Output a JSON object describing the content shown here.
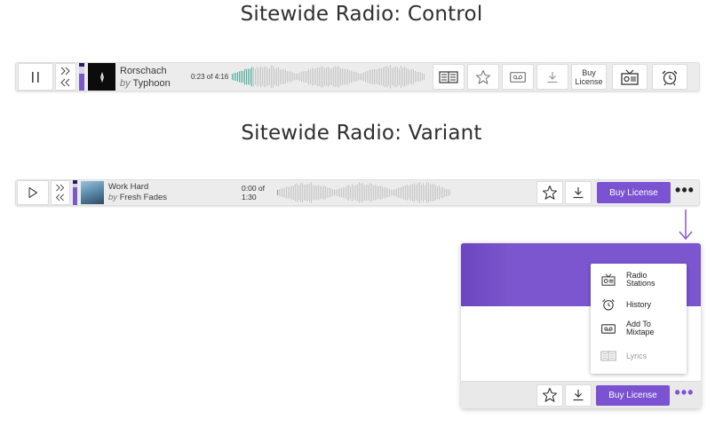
{
  "titles": {
    "control": "Sitewide Radio: Control",
    "variant": "Sitewide Radio: Variant"
  },
  "control_bar": {
    "track_title": "Rorschach",
    "artist_prefix": "by",
    "artist": "Typhoon",
    "time": "0:23 of 4:16",
    "buy_label_line1": "Buy",
    "buy_label_line2": "License",
    "icons": [
      "pause-icon",
      "skip-forward-icon",
      "skip-back-icon",
      "lyrics-icon",
      "star-icon",
      "mixtape-icon",
      "download-icon",
      "radio-icon",
      "alarm-clock-icon"
    ]
  },
  "variant_bar": {
    "track_title": "Work Hard",
    "artist_prefix": "by",
    "artist": "Fresh Fades",
    "time_line1": "0:00 of",
    "time_line2": "1:30",
    "buy_label": "Buy License",
    "more_label": "•••",
    "icons": [
      "play-icon",
      "skip-forward-icon",
      "skip-back-icon",
      "star-icon",
      "download-icon",
      "more-icon"
    ]
  },
  "overflow_menu": {
    "items": [
      {
        "label": "Radio Stations",
        "icon": "radio-icon",
        "enabled": true
      },
      {
        "label": "History",
        "icon": "alarm-clock-icon",
        "enabled": true
      },
      {
        "label": "Add To Mixtape",
        "icon": "mixtape-icon",
        "enabled": true
      },
      {
        "label": "Lyrics",
        "icon": "lyrics-icon",
        "enabled": false
      }
    ]
  },
  "panel_footer": {
    "buy_label": "Buy License",
    "more_label": "•••"
  },
  "colors": {
    "accent": "#7b52d2",
    "accent_arrow": "#8a63d6",
    "bar_bg": "#ececec",
    "waveform_played": "#4fae9b",
    "waveform_unplayed": "#c6c6c6"
  }
}
